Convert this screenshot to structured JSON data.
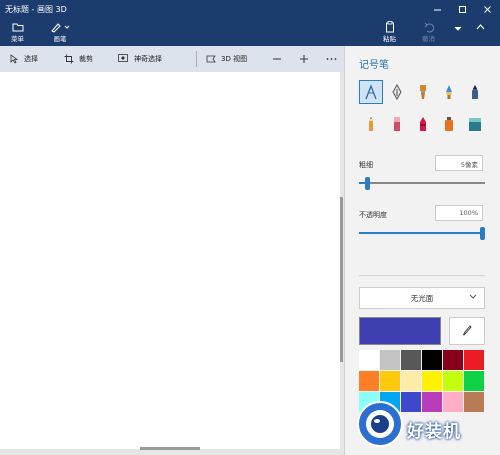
{
  "window": {
    "title": "无标题 - 画图 3D"
  },
  "ribbon": {
    "menu_label": "菜单",
    "brushes_label": "画笔",
    "paste_label": "粘贴",
    "undo_label": "撤消"
  },
  "toolbar": {
    "select_label": "选择",
    "crop_label": "裁剪",
    "magic_select_label": "神奇选择",
    "view3d_label": "3D 视图"
  },
  "panel": {
    "title": "记号笔",
    "thickness_label": "粗细",
    "thickness_value": "5像素",
    "thickness_fraction": 0.05,
    "opacity_label": "不透明度",
    "opacity_value": "100%",
    "opacity_fraction": 1.0,
    "finish_value": "无光面",
    "tools": [
      "marker-icon",
      "calligraphy-pen-icon",
      "oil-brush-icon",
      "watercolor-icon",
      "pixel-pen-icon",
      "pencil-icon",
      "eraser-icon",
      "crayon-icon",
      "spraycan-icon",
      "fill-icon"
    ],
    "current_color": "#3f3eb0",
    "palette": [
      "#ffffff",
      "#c3c3c3",
      "#585858",
      "#000000",
      "#88001b",
      "#ec1c24",
      "#ff7f27",
      "#ffc90e",
      "#fdeca6",
      "#fff200",
      "#c4ff0e",
      "#0ed145",
      "#8cfffb",
      "#00a8f3",
      "#3f48cc",
      "#b83dba",
      "#ffaec8",
      "#b97a56"
    ]
  },
  "watermark": {
    "text": "好装机"
  }
}
